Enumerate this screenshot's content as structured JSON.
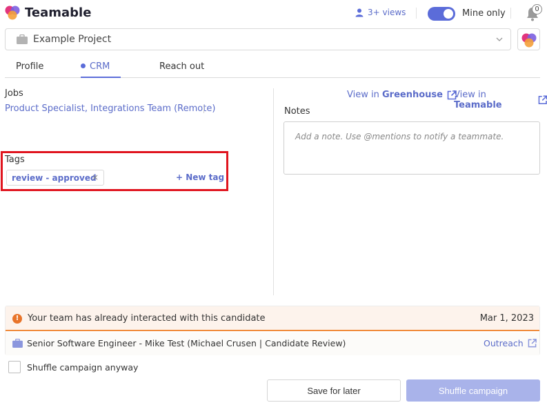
{
  "header": {
    "brand": "Teamable",
    "views": "3+ views",
    "mine_only": "Mine only",
    "notification_count": "0",
    "colors": {
      "accent": "#5b6cd9",
      "toggle_on": "#5b6cd9"
    }
  },
  "project": {
    "selected": "Example Project"
  },
  "tabs": [
    {
      "label": "Profile",
      "active": false
    },
    {
      "label": "CRM",
      "active": true
    },
    {
      "label": "Reach out",
      "active": false
    }
  ],
  "jobs": {
    "title": "Jobs",
    "items": [
      "Product Specialist, Integrations Team (Remote)"
    ]
  },
  "tags": {
    "title": "Tags",
    "items": [
      "review - approved"
    ],
    "remove_symbol": "×",
    "new_tag": "+ New tag"
  },
  "links": {
    "greenhouse_prefix": "View in",
    "greenhouse_name": "Greenhouse",
    "teamable_prefix": "View in",
    "teamable_name": "Teamable"
  },
  "notes": {
    "title": "Notes",
    "placeholder": "Add a note. Use @mentions to notify a teammate."
  },
  "warning": {
    "text": "Your team has already interacted with this candidate",
    "date": "Mar 1, 2023",
    "color": "#e8742a"
  },
  "interaction": {
    "text": "Senior Software Engineer - Mike Test  (Michael Crusen | Candidate Review)",
    "link": "Outreach"
  },
  "footer": {
    "checkbox_label": "Shuffle campaign anyway",
    "save_label": "Save for later",
    "shuffle_label": "Shuffle campaign"
  }
}
